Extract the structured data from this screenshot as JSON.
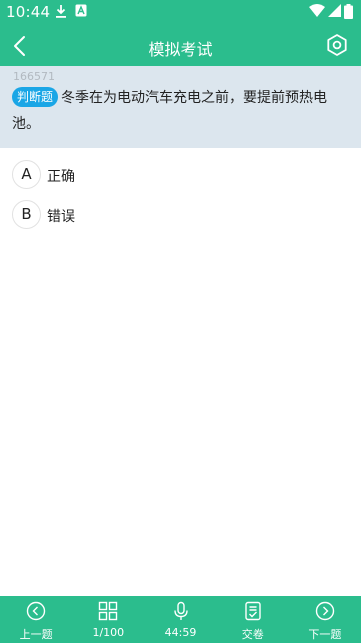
{
  "status_bar": {
    "time": "10:44",
    "icons": [
      "download-icon",
      "notification-a-icon",
      "wifi-icon",
      "signal-icon",
      "battery-icon"
    ]
  },
  "header": {
    "title": "模拟考试",
    "back_icon": "chevron-left-icon",
    "settings_icon": "settings-hexagon-icon"
  },
  "question": {
    "id": "166571",
    "type_tag": "判断题",
    "text": "冬季在为电动汽车充电之前，要提前预热电池。"
  },
  "options": [
    {
      "letter": "A",
      "label": "正确"
    },
    {
      "letter": "B",
      "label": "错误"
    }
  ],
  "bottom_nav": [
    {
      "icon": "arrow-left-circle-icon",
      "label": "上一题"
    },
    {
      "icon": "grid-icon",
      "label": "1/100"
    },
    {
      "icon": "microphone-icon",
      "label": "44:59"
    },
    {
      "icon": "submit-paper-icon",
      "label": "交卷"
    },
    {
      "icon": "arrow-right-circle-icon",
      "label": "下一题"
    }
  ],
  "colors": {
    "primary": "#2bbd8d",
    "question_bg": "#dce6ee",
    "tag_bg": "#1aa6e6"
  }
}
